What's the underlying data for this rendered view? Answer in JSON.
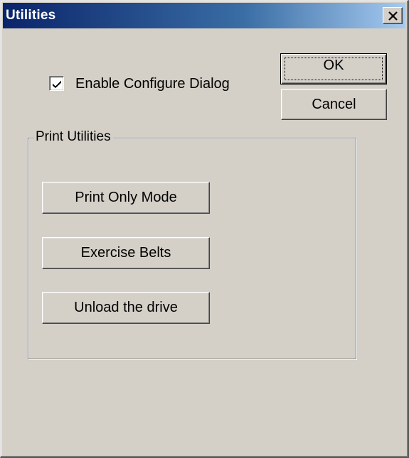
{
  "window": {
    "title": "Utilities",
    "close_icon": "close-icon"
  },
  "config": {
    "enable_label": "Enable Configure Dialog",
    "enable_checked": true
  },
  "buttons": {
    "ok_label": "OK",
    "cancel_label": "Cancel"
  },
  "print_utilities": {
    "group_title": "Print Utilities",
    "print_only_label": "Print Only Mode",
    "exercise_belts_label": "Exercise Belts",
    "unload_drive_label": "Unload the drive"
  },
  "colors": {
    "titlebar_start": "#0a246a",
    "titlebar_end": "#a6caf0",
    "dialog_face": "#d4d0c8"
  }
}
